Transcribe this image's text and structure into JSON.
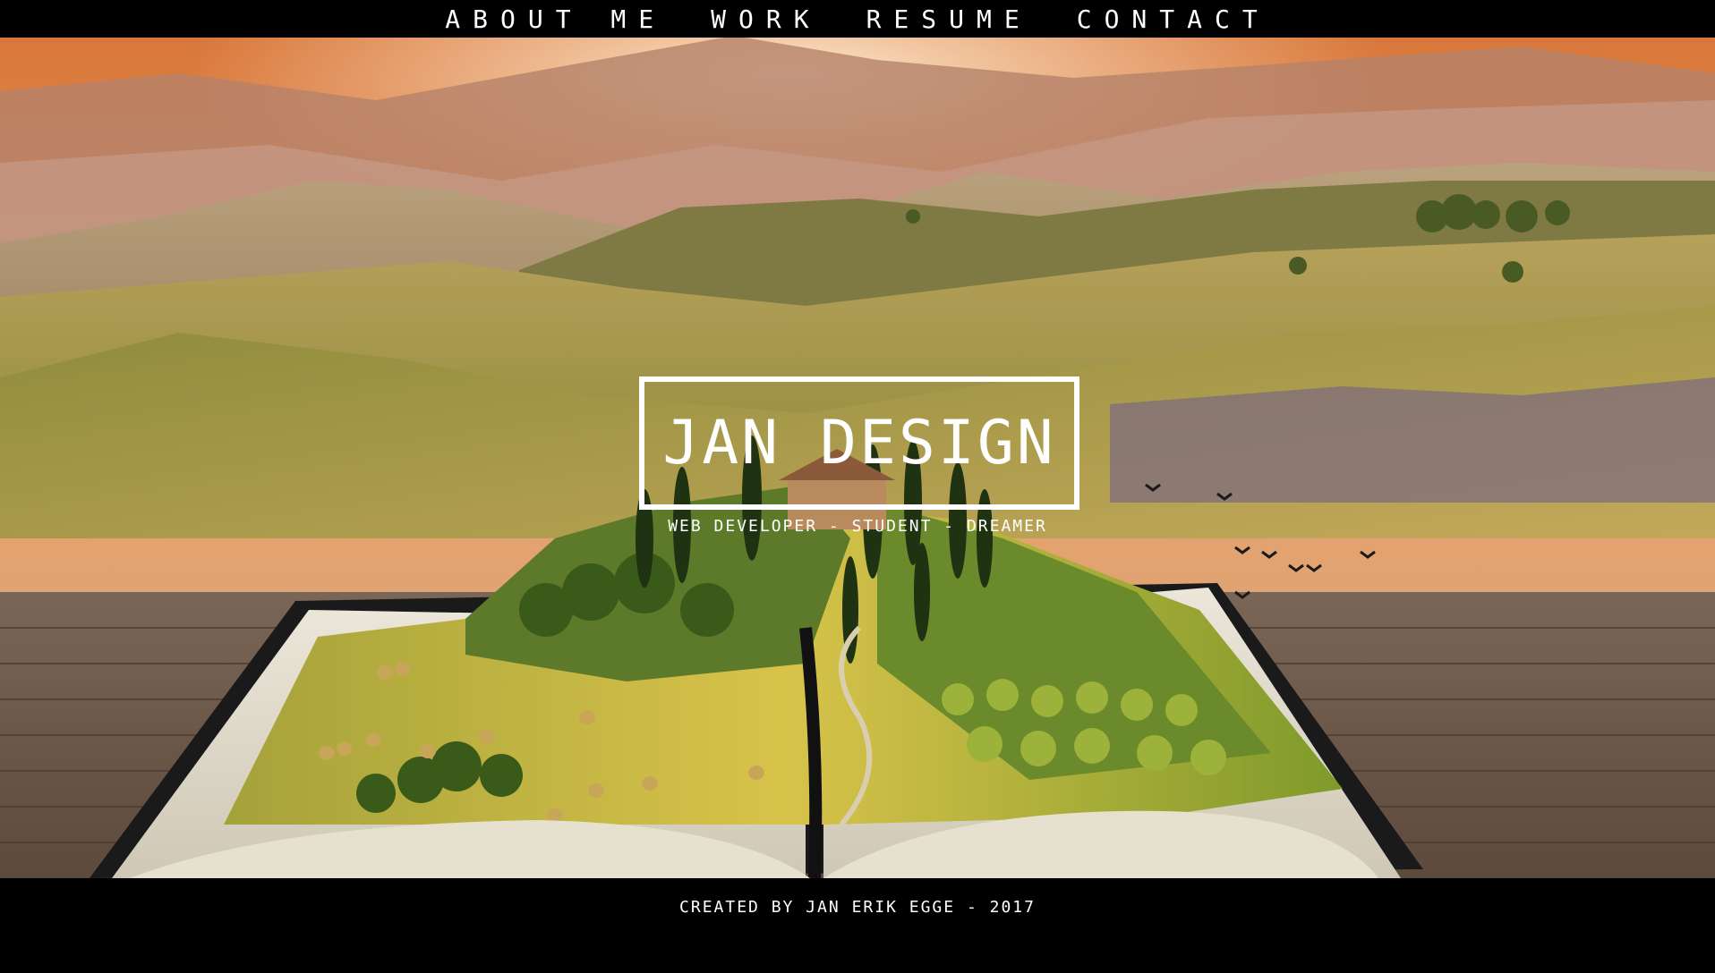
{
  "nav": {
    "items": [
      {
        "label": "ABOUT ME"
      },
      {
        "label": "WORK"
      },
      {
        "label": "RESUME"
      },
      {
        "label": "CONTACT"
      }
    ]
  },
  "hero": {
    "title": "JAN DESIGN",
    "tagline": "WEB DEVELOPER - STUDENT - DREAMER",
    "image": "open-book-landscape-hero-image"
  },
  "footer": {
    "text": "CREATED BY JAN ERIK EGGE - 2017"
  },
  "colors": {
    "bar": "#000000",
    "text": "#ffffff",
    "sky": "#e08a4a",
    "hills": "#9a8a45",
    "wood": "#6e5a4b"
  }
}
